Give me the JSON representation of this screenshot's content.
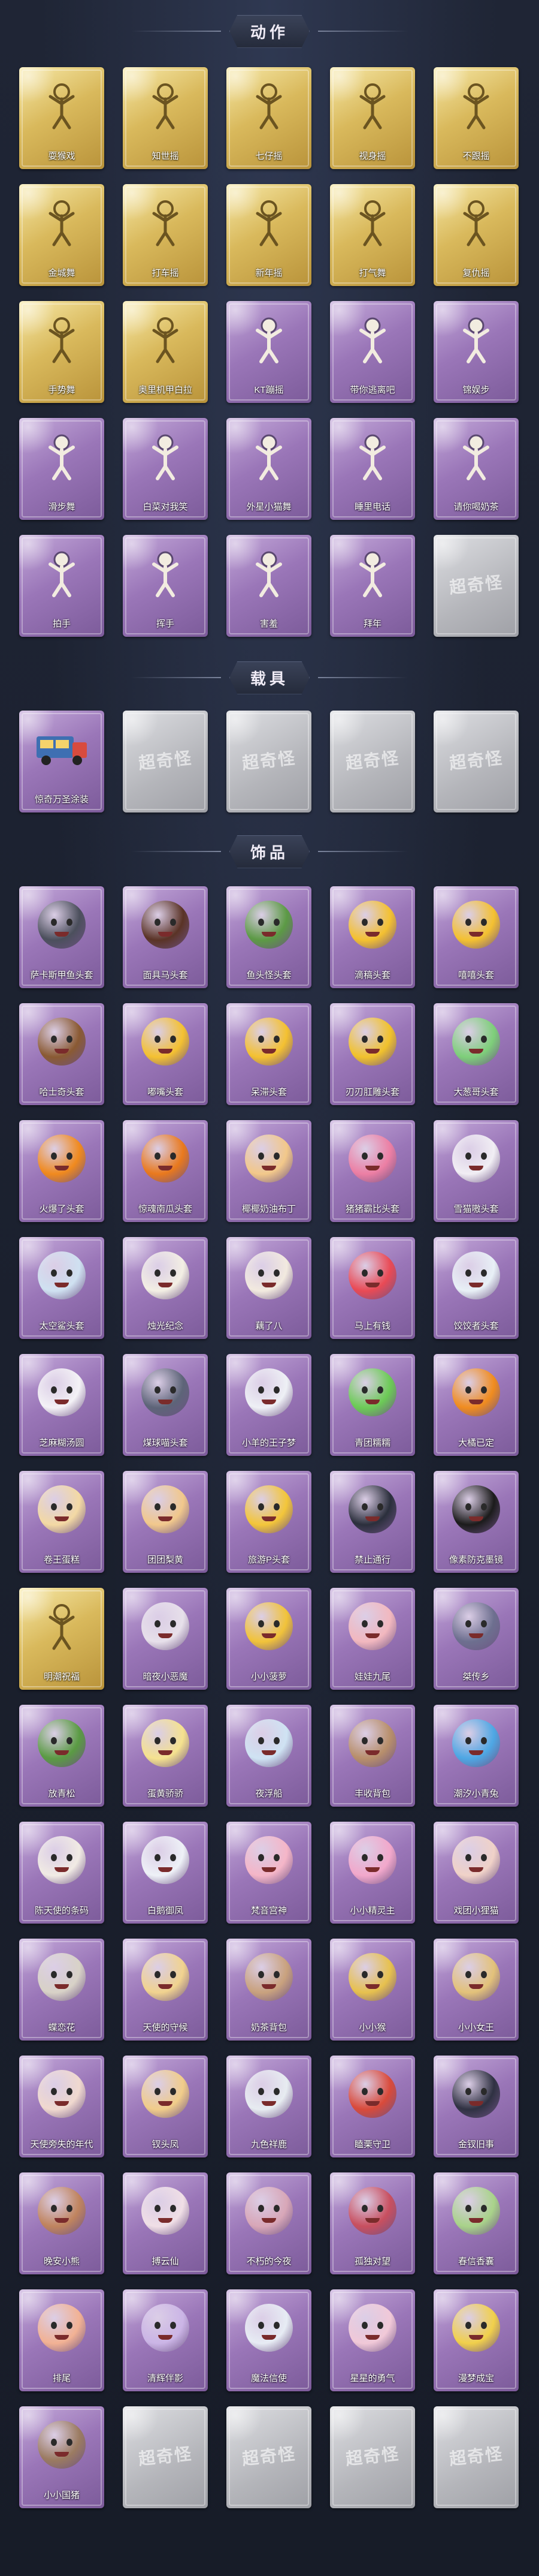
{
  "sections": {
    "actions": {
      "title": "动作"
    },
    "vehicles": {
      "title": "载具"
    },
    "items": {
      "title": "饰品"
    }
  },
  "placeholder_watermark": "超奇怪",
  "actions": [
    {
      "label": "耍猴戏",
      "tier": "gold",
      "icon": "figure-icon"
    },
    {
      "label": "知世摇",
      "tier": "gold",
      "icon": "figure-icon"
    },
    {
      "label": "七仔摇",
      "tier": "gold",
      "icon": "figure-icon"
    },
    {
      "label": "视身摇",
      "tier": "gold",
      "icon": "figure-icon"
    },
    {
      "label": "不跟摇",
      "tier": "gold",
      "icon": "figure-icon"
    },
    {
      "label": "金城舞",
      "tier": "gold",
      "icon": "figure-icon"
    },
    {
      "label": "打车摇",
      "tier": "gold",
      "icon": "figure-icon"
    },
    {
      "label": "新年摇",
      "tier": "gold",
      "icon": "figure-icon"
    },
    {
      "label": "打气舞",
      "tier": "gold",
      "icon": "figure-icon"
    },
    {
      "label": "复仇摇",
      "tier": "gold",
      "icon": "figure-icon"
    },
    {
      "label": "手势舞",
      "tier": "gold",
      "icon": "figure-icon"
    },
    {
      "label": "奥里机甲白拉",
      "tier": "gold",
      "icon": "figure-icon"
    },
    {
      "label": "KT蹦摇",
      "tier": "purple",
      "icon": "figure-icon"
    },
    {
      "label": "带你逃离吧",
      "tier": "purple",
      "icon": "figure-icon"
    },
    {
      "label": "锦娱步",
      "tier": "purple",
      "icon": "figure-icon"
    },
    {
      "label": "滑步舞",
      "tier": "purple",
      "icon": "figure-icon"
    },
    {
      "label": "白菜对我笑",
      "tier": "purple",
      "icon": "figure-icon"
    },
    {
      "label": "外星小猫舞",
      "tier": "purple",
      "icon": "figure-icon"
    },
    {
      "label": "睡里电话",
      "tier": "purple",
      "icon": "figure-icon"
    },
    {
      "label": "请你喝奶茶",
      "tier": "purple",
      "icon": "figure-icon"
    },
    {
      "label": "拍手",
      "tier": "purple",
      "icon": "figure-icon"
    },
    {
      "label": "挥手",
      "tier": "purple",
      "icon": "figure-icon"
    },
    {
      "label": "害羞",
      "tier": "purple",
      "icon": "figure-icon"
    },
    {
      "label": "拜年",
      "tier": "purple",
      "icon": "figure-icon"
    },
    {
      "label": "",
      "tier": "grey",
      "icon": "locked-placeholder-icon"
    }
  ],
  "vehicles": [
    {
      "label": "惊奇万圣涂装",
      "tier": "purple",
      "icon": "food-truck-icon"
    },
    {
      "label": "",
      "tier": "grey",
      "icon": "locked-placeholder-icon"
    },
    {
      "label": "",
      "tier": "grey",
      "icon": "locked-placeholder-icon"
    },
    {
      "label": "",
      "tier": "grey",
      "icon": "locked-placeholder-icon"
    },
    {
      "label": "",
      "tier": "grey",
      "icon": "locked-placeholder-icon"
    }
  ],
  "items": [
    {
      "label": "萨卡斯甲鱼头套",
      "tier": "purple",
      "icon": "fish-mask-icon",
      "color": "#4b4f5c"
    },
    {
      "label": "面具马头套",
      "tier": "purple",
      "icon": "horse-mask-icon",
      "color": "#5a3326"
    },
    {
      "label": "鱼头怪头套",
      "tier": "purple",
      "icon": "fish-head-icon",
      "color": "#5c9a45"
    },
    {
      "label": "滴稿头套",
      "tier": "purple",
      "icon": "smiley-icon",
      "color": "#f4c131"
    },
    {
      "label": "嘻嘻头套",
      "tier": "purple",
      "icon": "grin-icon",
      "color": "#f4c131"
    },
    {
      "label": "哈士奇头套",
      "tier": "purple",
      "icon": "husky-icon",
      "color": "#8a5a33"
    },
    {
      "label": "嘟嘴头套",
      "tier": "purple",
      "icon": "pout-icon",
      "color": "#f4c131"
    },
    {
      "label": "呆滞头套",
      "tier": "purple",
      "icon": "dazed-icon",
      "color": "#f4c131"
    },
    {
      "label": "刃刃肛雕头套",
      "tier": "purple",
      "icon": "cool-bird-icon",
      "color": "#f1c22c"
    },
    {
      "label": "大葱哥头套",
      "tier": "purple",
      "icon": "onion-icon",
      "color": "#7ecf7a"
    },
    {
      "label": "火爆了头套",
      "tier": "purple",
      "icon": "fire-icon",
      "color": "#f08a1e"
    },
    {
      "label": "惊魂南瓜头套",
      "tier": "purple",
      "icon": "pumpkin-icon",
      "color": "#e9791d"
    },
    {
      "label": "椰椰奶油布丁",
      "tier": "purple",
      "icon": "pudding-icon",
      "color": "#f2c88a"
    },
    {
      "label": "猪猪霸比头套",
      "tier": "purple",
      "icon": "pig-icon",
      "color": "#ec7fa4"
    },
    {
      "label": "雪猫嗷头套",
      "tier": "purple",
      "icon": "snow-cat-icon",
      "color": "#f1eef4"
    },
    {
      "label": "太空鲨头套",
      "tier": "purple",
      "icon": "shark-icon",
      "color": "#cfe1f1"
    },
    {
      "label": "烛光纪念",
      "tier": "purple",
      "icon": "candle-icon",
      "color": "#f3efe4"
    },
    {
      "label": "藕了八",
      "tier": "purple",
      "icon": "dumpling-icon",
      "color": "#f2eadf"
    },
    {
      "label": "马上有钱",
      "tier": "purple",
      "icon": "mushroom-icon",
      "color": "#e94a55"
    },
    {
      "label": "饺饺者头套",
      "tier": "purple",
      "icon": "dumpling-icon",
      "color": "#e8f0f6"
    },
    {
      "label": "芝麻糊汤圆",
      "tier": "purple",
      "icon": "tangyuan-icon",
      "color": "#f4f2f6"
    },
    {
      "label": "煤球喵头套",
      "tier": "purple",
      "icon": "cat-icon",
      "color": "#5d6478"
    },
    {
      "label": "小羊的王子梦",
      "tier": "purple",
      "icon": "sheep-icon",
      "color": "#eef0f5"
    },
    {
      "label": "青团糯糯",
      "tier": "purple",
      "icon": "green-bun-icon",
      "color": "#6ccb56"
    },
    {
      "label": "大橘已定",
      "tier": "purple",
      "icon": "orange-icon",
      "color": "#f08c1f"
    },
    {
      "label": "卷王蛋糕",
      "tier": "purple",
      "icon": "cake-icon",
      "color": "#f3d9a4"
    },
    {
      "label": "团团梨黄",
      "tier": "purple",
      "icon": "bun-cat-icon",
      "color": "#f1c88c"
    },
    {
      "label": "旅游P头套",
      "tier": "purple",
      "icon": "duck-icon",
      "color": "#f3c63a"
    },
    {
      "label": "禁止通行",
      "tier": "purple",
      "icon": "barrier-icon",
      "color": "#2b2f3c"
    },
    {
      "label": "像素防克墨镜",
      "tier": "purple",
      "icon": "pixel-glasses-icon",
      "color": "#1b1b1b"
    },
    {
      "label": "明潮祝福",
      "tier": "gold",
      "icon": "figure-icon",
      "color": "#efe5c8"
    },
    {
      "label": "暗夜小恶魔",
      "tier": "purple",
      "icon": "fox-mask-icon",
      "color": "#e7e0ea"
    },
    {
      "label": "小小菠萝",
      "tier": "purple",
      "icon": "pineapple-icon",
      "color": "#f1c33a"
    },
    {
      "label": "娃娃九尾",
      "tier": "purple",
      "icon": "nine-tail-icon",
      "color": "#f2b8bf"
    },
    {
      "label": "桀传乡",
      "tier": "purple",
      "icon": "doll-icon",
      "color": "#6d6f8f"
    },
    {
      "label": "放青松",
      "tier": "purple",
      "icon": "bonsai-icon",
      "color": "#5a9b43"
    },
    {
      "label": "蛋黄骄骄",
      "tier": "purple",
      "icon": "egg-chick-icon",
      "color": "#f5e28f"
    },
    {
      "label": "夜浮船",
      "tier": "purple",
      "icon": "ice-icon",
      "color": "#cfe3f3"
    },
    {
      "label": "丰收背包",
      "tier": "purple",
      "icon": "backpack-icon",
      "color": "#b88f6b"
    },
    {
      "label": "潮汐小青兔",
      "tier": "purple",
      "icon": "blue-rabbit-icon",
      "color": "#4ea7e4"
    },
    {
      "label": "陈天使的条码",
      "tier": "purple",
      "icon": "angel-icon",
      "color": "#f1ebe4"
    },
    {
      "label": "白鹅御凤",
      "tier": "purple",
      "icon": "ghost-icon",
      "color": "#eef1f7"
    },
    {
      "label": "梵音宫神",
      "tier": "purple",
      "icon": "doll-icon",
      "color": "#f5b6c8"
    },
    {
      "label": "小小精灵主",
      "tier": "purple",
      "icon": "doll-icon",
      "color": "#f2a8cb"
    },
    {
      "label": "戏团小狸猫",
      "tier": "purple",
      "icon": "doll-icon",
      "color": "#f0d2c8"
    },
    {
      "label": "蝶恋花",
      "tier": "purple",
      "icon": "butterfly-icon",
      "color": "#d8d2c7"
    },
    {
      "label": "天使的守候",
      "tier": "purple",
      "icon": "angel-icon",
      "color": "#f1d38f"
    },
    {
      "label": "奶茶背包",
      "tier": "purple",
      "icon": "milk-tea-icon",
      "color": "#c9a27e"
    },
    {
      "label": "小小猴",
      "tier": "purple",
      "icon": "monkey-icon",
      "color": "#e7c14e"
    },
    {
      "label": "小小女王",
      "tier": "purple",
      "icon": "queen-icon",
      "color": "#e3c27a"
    },
    {
      "label": "天使旁失的年代",
      "tier": "purple",
      "icon": "doll-icon",
      "color": "#f0d9cf"
    },
    {
      "label": "钗头凤",
      "tier": "purple",
      "icon": "phoenix-icon",
      "color": "#f1cd8a"
    },
    {
      "label": "九色祥鹿",
      "tier": "purple",
      "icon": "deer-icon",
      "color": "#e7ecf1"
    },
    {
      "label": "瞌栗守卫",
      "tier": "purple",
      "icon": "lantern-icon",
      "color": "#d94a3a"
    },
    {
      "label": "金钗旧事",
      "tier": "purple",
      "icon": "doll-icon",
      "color": "#2f3142"
    },
    {
      "label": "晚安小熊",
      "tier": "purple",
      "icon": "bear-icon",
      "color": "#c0845e"
    },
    {
      "label": "搏云仙",
      "tier": "purple",
      "icon": "cloud-fairy-icon",
      "color": "#f0dfe6"
    },
    {
      "label": "不朽的今夜",
      "tier": "purple",
      "icon": "doll-icon",
      "color": "#d8a7b8"
    },
    {
      "label": "孤独对望",
      "tier": "purple",
      "icon": "charm-icon",
      "color": "#c84f5f"
    },
    {
      "label": "春信香囊",
      "tier": "purple",
      "icon": "sachet-icon",
      "color": "#a9d38a"
    },
    {
      "label": "排尾",
      "tier": "purple",
      "icon": "fox-icon",
      "color": "#f2b294"
    },
    {
      "label": "清辉伴影",
      "tier": "purple",
      "icon": "doll-icon",
      "color": "#cbb5e6"
    },
    {
      "label": "魔法信使",
      "tier": "purple",
      "icon": "mouse-icon",
      "color": "#e7ecf4"
    },
    {
      "label": "星星的勇气",
      "tier": "purple",
      "icon": "doll-icon",
      "color": "#f1c9d8"
    },
    {
      "label": "漫梦成宝",
      "tier": "purple",
      "icon": "robot-icon",
      "color": "#f1d04b"
    },
    {
      "label": "小小国猪",
      "tier": "purple",
      "icon": "doll-icon",
      "color": "#9b7b61"
    },
    {
      "label": "",
      "tier": "grey",
      "icon": "locked-placeholder-icon"
    },
    {
      "label": "",
      "tier": "grey",
      "icon": "locked-placeholder-icon"
    },
    {
      "label": "",
      "tier": "grey",
      "icon": "locked-placeholder-icon"
    },
    {
      "label": "",
      "tier": "grey",
      "icon": "locked-placeholder-icon"
    }
  ]
}
